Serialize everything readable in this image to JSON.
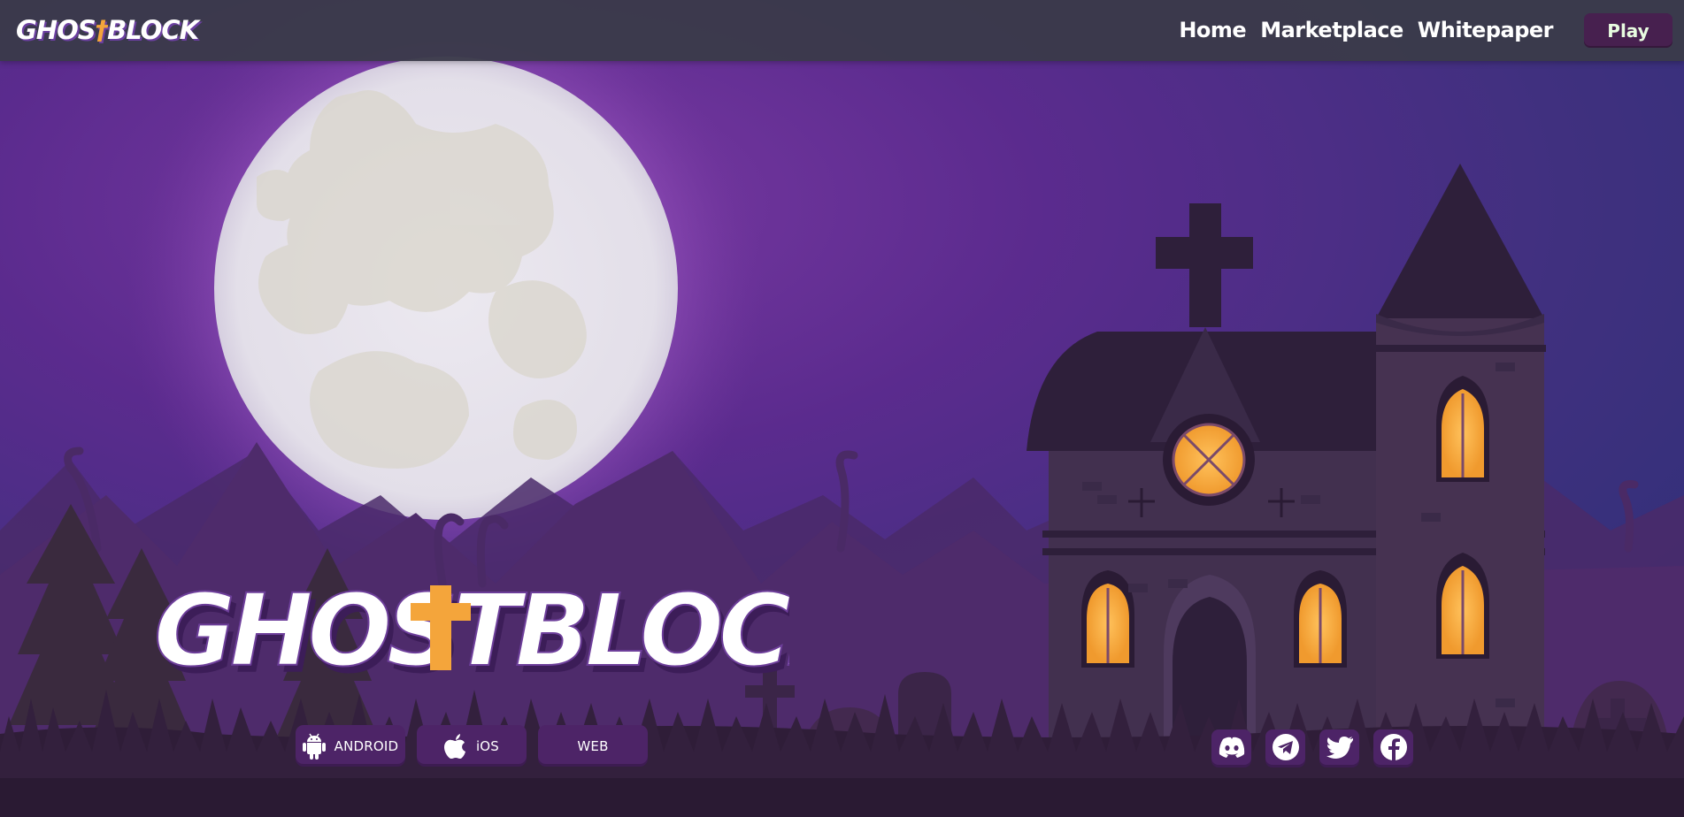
{
  "brand": {
    "logo_text_before": "GHOS",
    "logo_cross": "†",
    "logo_text_after": "BLOCK"
  },
  "nav": {
    "items": [
      {
        "label": "Home"
      },
      {
        "label": "Marketplace"
      },
      {
        "label": "Whitepaper"
      }
    ]
  },
  "play_button": {
    "label": "Play"
  },
  "hero": {
    "logo_text": "GHOSTBLOCK"
  },
  "platforms": [
    {
      "label": "ANDROID",
      "icon": "android-icon"
    },
    {
      "label": "iOS",
      "icon": "apple-icon"
    },
    {
      "label": "WEB",
      "icon": ""
    }
  ],
  "socials": [
    {
      "name": "Discord",
      "icon": "discord-icon"
    },
    {
      "name": "Telegram",
      "icon": "telegram-icon"
    },
    {
      "name": "Twitter",
      "icon": "twitter-icon"
    },
    {
      "name": "Facebook",
      "icon": "facebook-icon"
    }
  ],
  "colors": {
    "sky": "#5a2d8c",
    "moon": "#e6e2ec",
    "nav_bg": "#3a3a4a",
    "button_bg": "#4d2467",
    "window_glow": "#f2a33a"
  }
}
